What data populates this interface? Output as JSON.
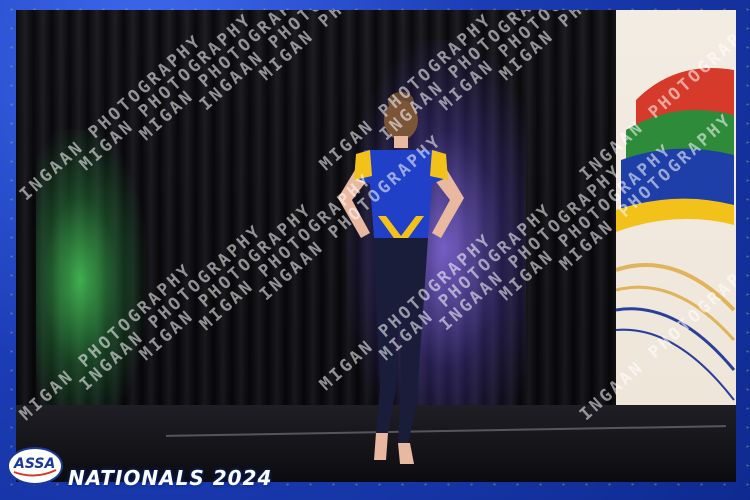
{
  "event": {
    "logo_text": "ASSA",
    "title": "NATIONALS 2024"
  },
  "watermark": {
    "text": "MIGAN PHOTOGRAPHY",
    "alt_text": "INGAAN PHOTOGRAPHY"
  },
  "colors": {
    "frame": "#1b3cb5",
    "stage_green_light": "#46c85a",
    "stage_purple_light": "#9678ff",
    "costume_blue": "#2140c8",
    "costume_yellow": "#f2c21b"
  }
}
